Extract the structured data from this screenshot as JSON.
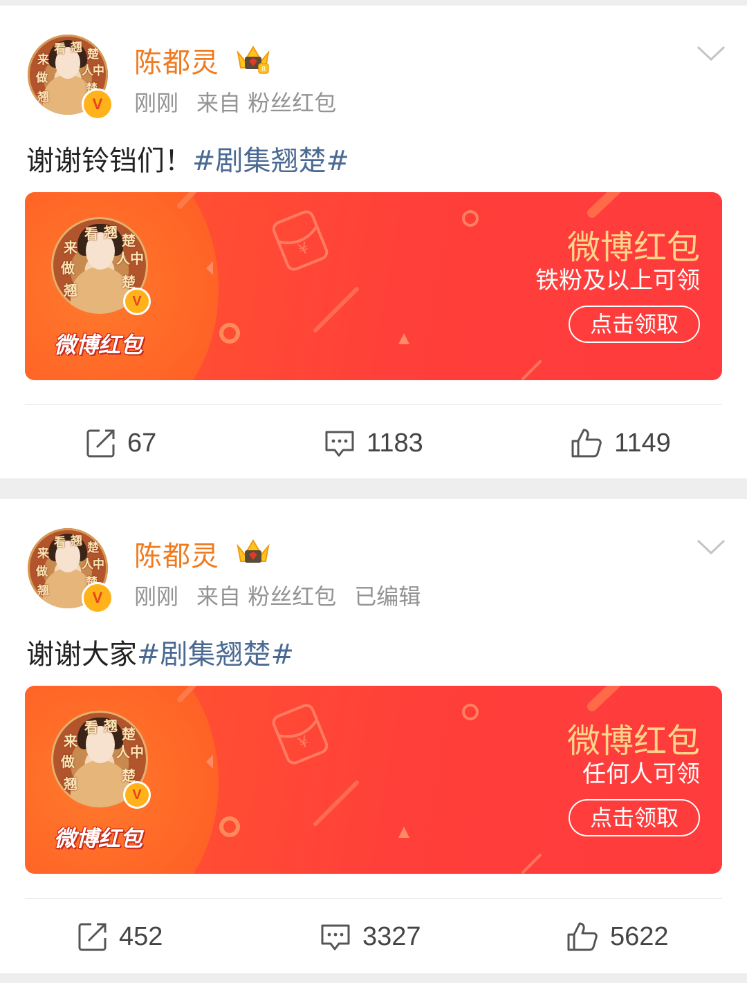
{
  "posts": [
    {
      "author": "陈都灵",
      "time": "刚刚",
      "source": "来自 粉丝红包",
      "edited": "",
      "text_main": "谢谢铃铛们！",
      "text_tag": "#剧集翘楚#",
      "card": {
        "title": "微博红包",
        "subtitle": "铁粉及以上可领",
        "button": "点击领取",
        "brand": "微博红包"
      },
      "stats": {
        "reposts": "67",
        "comments": "1183",
        "likes": "1149"
      }
    },
    {
      "author": "陈都灵",
      "time": "刚刚",
      "source": "来自 粉丝红包",
      "edited": "已编辑",
      "text_main": "谢谢大家",
      "text_tag": "#剧集翘楚#",
      "card": {
        "title": "微博红包",
        "subtitle": "任何人可领",
        "button": "点击领取",
        "brand": "微博红包"
      },
      "stats": {
        "reposts": "452",
        "comments": "3327",
        "likes": "5622"
      }
    }
  ],
  "avatar_text": [
    "来",
    "看",
    "翘",
    "楚",
    "做",
    "人",
    "中",
    "翘",
    "楚"
  ],
  "icons": [
    "verified-badge-icon",
    "crown-badge-icon",
    "chevron-down-icon",
    "repost-icon",
    "comment-icon",
    "like-icon"
  ],
  "colors": {
    "username": "#f07a1f",
    "hashtag": "#4a6a93",
    "card_bg": "#ff4438",
    "card_title": "#ffd58a"
  }
}
